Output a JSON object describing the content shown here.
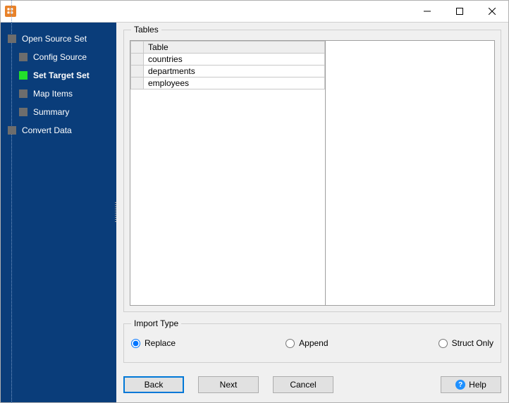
{
  "titlebar": {
    "title": ""
  },
  "sidebar": {
    "steps": [
      {
        "label": "Open Source Set",
        "child": false,
        "active": false
      },
      {
        "label": "Config Source",
        "child": true,
        "active": false
      },
      {
        "label": "Set Target Set",
        "child": true,
        "active": true
      },
      {
        "label": "Map Items",
        "child": true,
        "active": false
      },
      {
        "label": "Summary",
        "child": true,
        "active": false
      },
      {
        "label": "Convert Data",
        "child": false,
        "active": false
      }
    ]
  },
  "tables_group": {
    "title": "Tables",
    "header": "Table",
    "rows": [
      "countries",
      "departments",
      "employees"
    ]
  },
  "import_type": {
    "title": "Import Type",
    "options": [
      {
        "label": "Replace",
        "selected": true
      },
      {
        "label": "Append",
        "selected": false
      },
      {
        "label": "Struct Only",
        "selected": false
      }
    ]
  },
  "buttons": {
    "back": "Back",
    "next": "Next",
    "cancel": "Cancel",
    "help": "Help"
  }
}
